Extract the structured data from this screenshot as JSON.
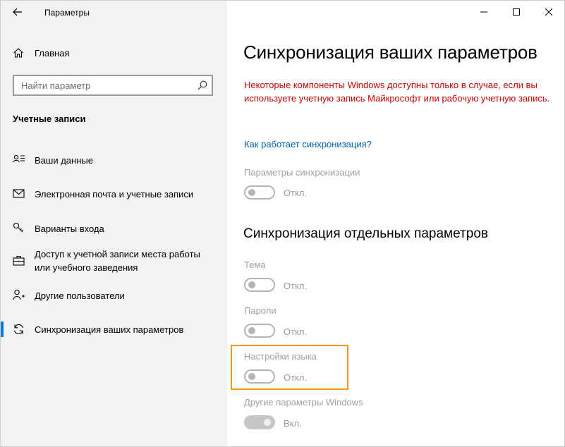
{
  "window": {
    "app_title": "Параметры",
    "controls": [
      "minimize",
      "maximize",
      "close"
    ]
  },
  "sidebar": {
    "home_label": "Главная",
    "search": {
      "placeholder": "Найти параметр",
      "value": ""
    },
    "section_heading": "Учетные записи",
    "items": [
      {
        "label": "Ваши данные",
        "icon": "person-card-icon",
        "selected": false
      },
      {
        "label": "Электронная почта и учетные записи",
        "icon": "mail-icon",
        "selected": false
      },
      {
        "label": "Варианты входа",
        "icon": "key-icon",
        "selected": false
      },
      {
        "label": "Доступ к учетной записи места работы или учебного заведения",
        "icon": "briefcase-icon",
        "selected": false
      },
      {
        "label": "Другие пользователи",
        "icon": "add-person-icon",
        "selected": false
      },
      {
        "label": "Синхронизация ваших параметров",
        "icon": "sync-icon",
        "selected": true
      }
    ]
  },
  "main": {
    "title": "Синхронизация ваших параметров",
    "warning": "Некоторые компоненты Windows доступны только в случае, если вы используете учетную запись Майкрософт или рабочую учетную запись.",
    "link": "Как работает синхронизация?",
    "sync_settings": {
      "label": "Параметры синхронизации",
      "state": "Откл.",
      "on": false
    },
    "individual_heading": "Синхронизация отдельных параметров",
    "individual": [
      {
        "label": "Тема",
        "state": "Откл.",
        "on": false
      },
      {
        "label": "Пароли",
        "state": "Откл.",
        "on": false
      },
      {
        "label": "Настройки языка",
        "state": "Откл.",
        "on": false,
        "highlighted": true
      },
      {
        "label": "Другие параметры Windows",
        "state": "Вкл.",
        "on": true
      }
    ]
  },
  "colors": {
    "accent": "#0078d7",
    "warning": "#c50500",
    "link": "#0063b1",
    "highlight": "#f7931e",
    "sidebar_bg": "#f2f2f2"
  }
}
